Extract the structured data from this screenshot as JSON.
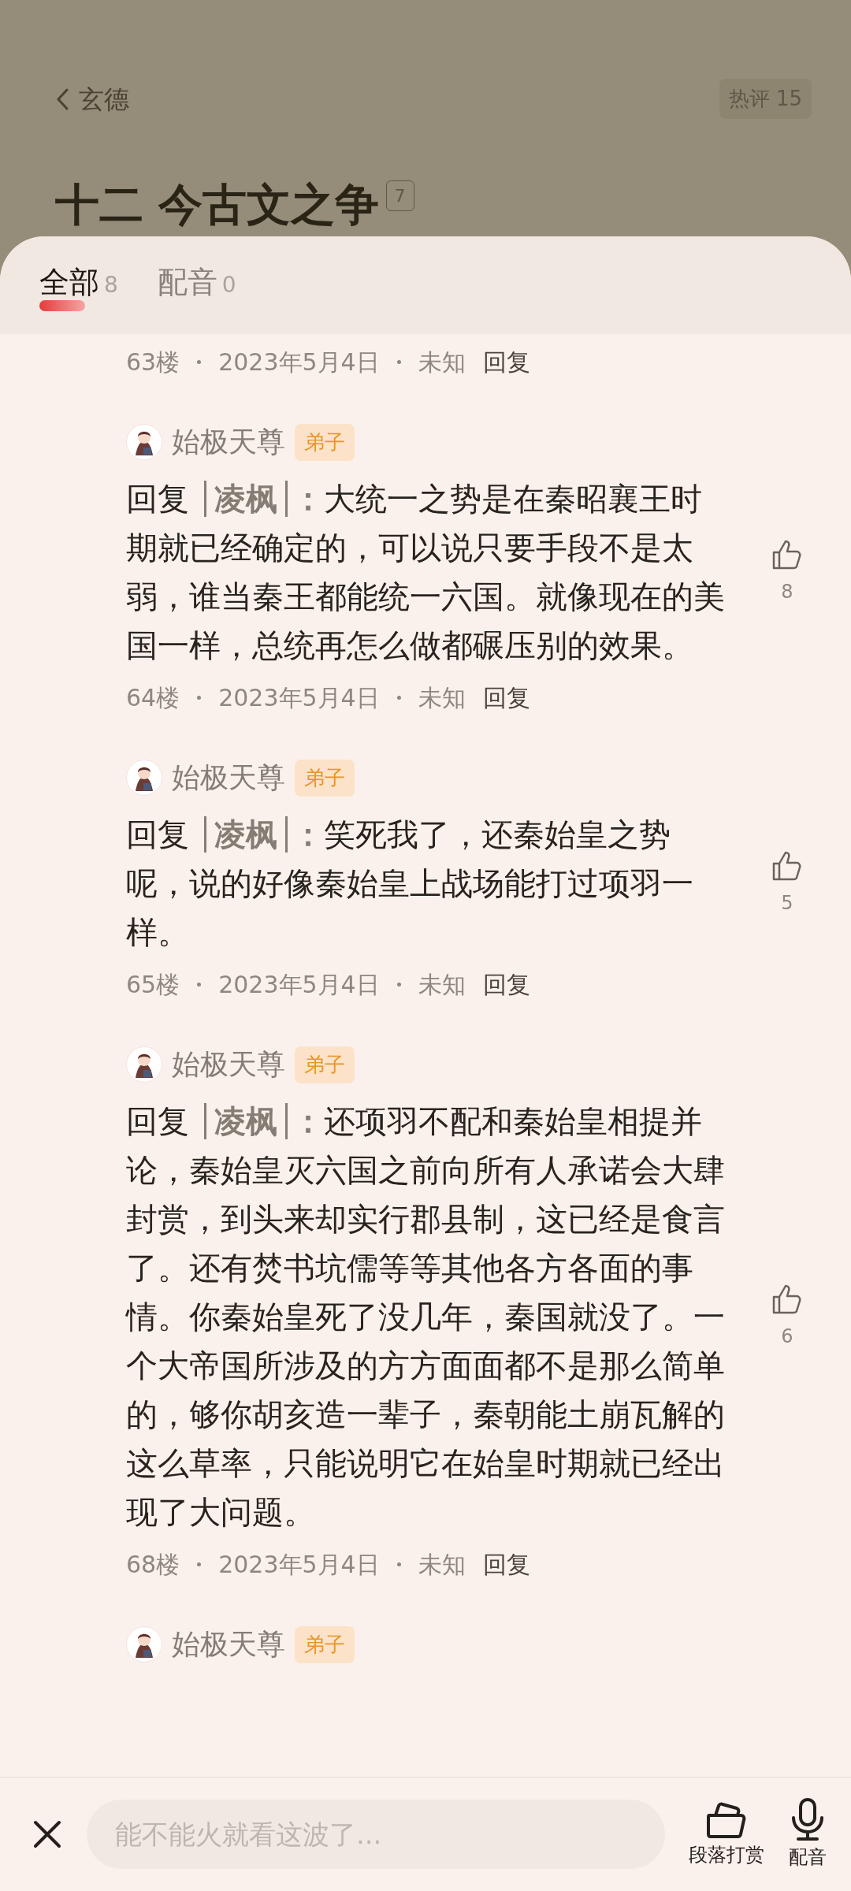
{
  "header": {
    "back_label": "玄德",
    "hot_comments": "热评 15",
    "chapter_title": "十二 今古文之争",
    "chapter_comment_count": "7"
  },
  "tabs": [
    {
      "label": "全部",
      "count": "8",
      "selected": true
    },
    {
      "label": "配音",
      "count": "0",
      "selected": false
    }
  ],
  "comments": [
    {
      "floor": "63楼",
      "date": "2023年5月4日",
      "location": "未知",
      "reply": "回复"
    },
    {
      "user": "始极天尊",
      "badge": "弟子",
      "reply_prefix": "回复",
      "reply_to": "凌枫",
      "reply_separator": "：",
      "text": "大统一之势是在秦昭襄王时期就已经确定的，可以说只要手段不是太弱，谁当秦王都能统一六国。就像现在的美国一样，总统再怎么做都碾压别的效果。",
      "likes": "8",
      "floor": "64楼",
      "date": "2023年5月4日",
      "location": "未知",
      "reply": "回复"
    },
    {
      "user": "始极天尊",
      "badge": "弟子",
      "reply_prefix": "回复",
      "reply_to": "凌枫",
      "reply_separator": "：",
      "text": "笑死我了，还秦始皇之势呢，说的好像秦始皇上战场能打过项羽一样。",
      "likes": "5",
      "floor": "65楼",
      "date": "2023年5月4日",
      "location": "未知",
      "reply": "回复"
    },
    {
      "user": "始极天尊",
      "badge": "弟子",
      "reply_prefix": "回复",
      "reply_to": "凌枫",
      "reply_separator": "：",
      "text": "还项羽不配和秦始皇相提并论，秦始皇灭六国之前向所有人承诺会大肆封赏，到头来却实行郡县制，这已经是食言了。还有焚书坑儒等等其他各方各面的事情。你秦始皇死了没几年，秦国就没了。一个大帝国所涉及的方方面面都不是那么简单的，够你胡亥造一辈子，秦朝能土崩瓦解的这么草率，只能说明它在始皇时期就已经出现了大问题。",
      "likes": "6",
      "floor": "68楼",
      "date": "2023年5月4日",
      "location": "未知",
      "reply": "回复"
    },
    {
      "user": "始极天尊",
      "badge": "弟子"
    }
  ],
  "bottom_bar": {
    "placeholder": "能不能火就看这波了...",
    "actions": [
      {
        "kind": "reward",
        "label": "段落打赏"
      },
      {
        "kind": "dub",
        "label": "配音"
      }
    ]
  }
}
